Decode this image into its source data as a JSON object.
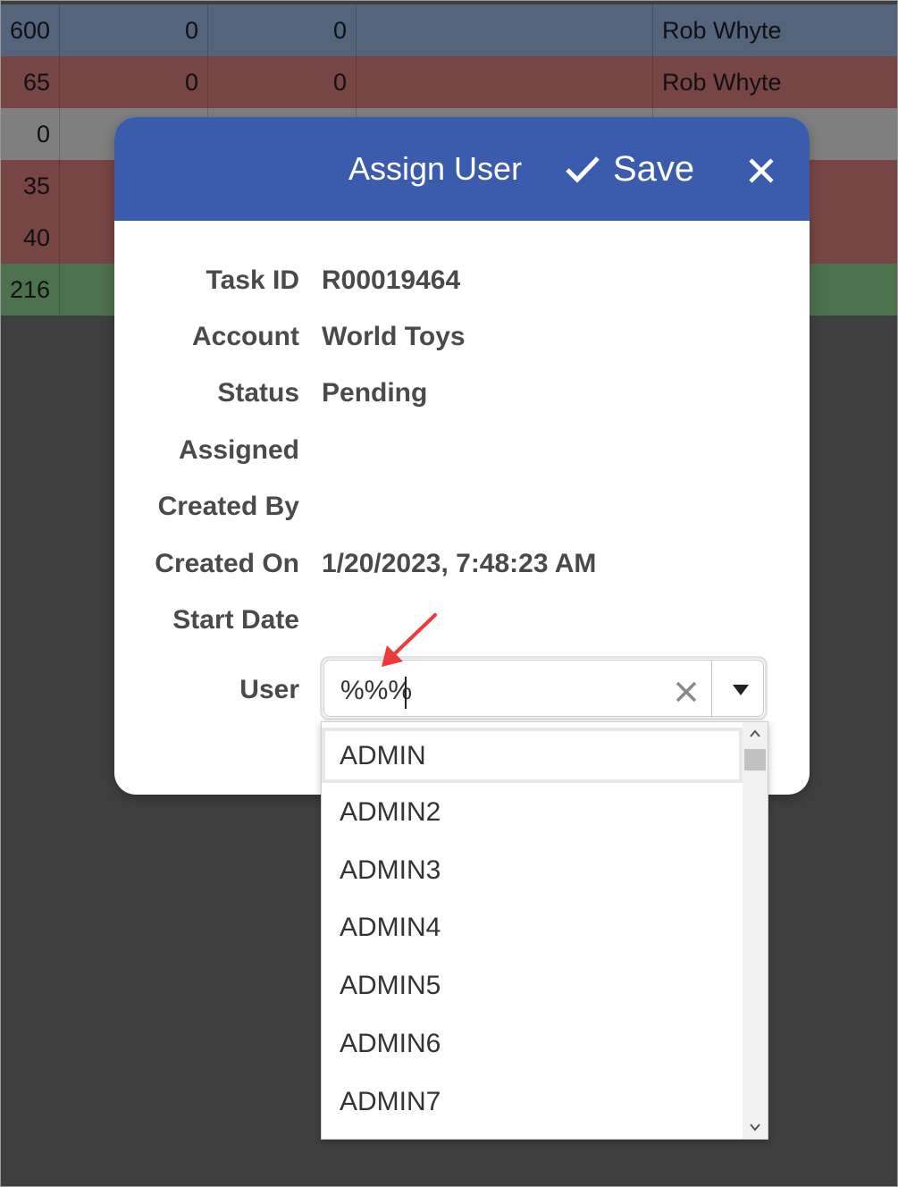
{
  "grid": {
    "rows": [
      {
        "c0": "600",
        "c1": "0",
        "c2": "0",
        "c3": "",
        "c4": "Rob Whyte",
        "color": "#a8c8f4"
      },
      {
        "c0": "65",
        "c1": "0",
        "c2": "0",
        "c3": "",
        "c4": "Rob Whyte",
        "color": "#f08a8a"
      },
      {
        "c0": "0",
        "c1": "",
        "c2": "",
        "c3": "",
        "c4": "",
        "color": "#ffffff"
      },
      {
        "c0": "35",
        "c1": "",
        "c2": "",
        "c3": "",
        "c4": "",
        "color": "#f08a8a"
      },
      {
        "c0": "40",
        "c1": "",
        "c2": "",
        "c3": "",
        "c4": "",
        "color": "#f08a8a"
      },
      {
        "c0": "216",
        "c1": "",
        "c2": "",
        "c3": "",
        "c4": "",
        "color": "#9be39b"
      }
    ]
  },
  "dialog": {
    "title": "Assign User",
    "save_label": "Save",
    "header_color": "#3b5bad",
    "fields": {
      "task_id": {
        "label": "Task ID",
        "value": "R00019464"
      },
      "account": {
        "label": "Account",
        "value": "World Toys"
      },
      "status": {
        "label": "Status",
        "value": "Pending"
      },
      "assigned": {
        "label": "Assigned",
        "value": ""
      },
      "created_by": {
        "label": "Created By",
        "value": ""
      },
      "created_on": {
        "label": "Created On",
        "value": "1/20/2023, 7:48:23 AM"
      },
      "start_date": {
        "label": "Start Date",
        "value": ""
      },
      "user": {
        "label": "User"
      }
    },
    "user_combo": {
      "value": "%%%",
      "clear_icon": "close-icon",
      "dropdown_icon": "triangle-down-icon",
      "options": [
        "ADMIN",
        "ADMIN2",
        "ADMIN3",
        "ADMIN4",
        "ADMIN5",
        "ADMIN6",
        "ADMIN7"
      ],
      "highlighted": "ADMIN"
    }
  },
  "annotation": {
    "color": "#ee3a3a"
  }
}
